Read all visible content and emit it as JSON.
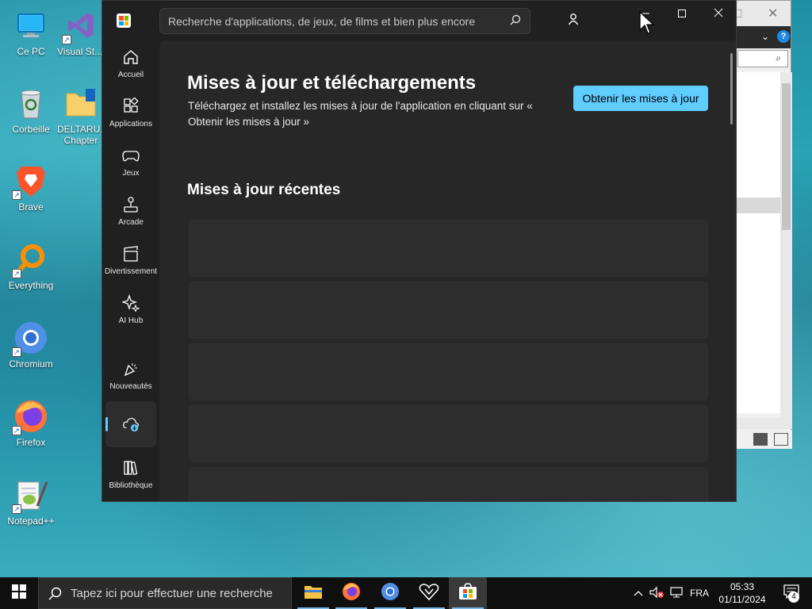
{
  "desktop": {
    "icons": [
      {
        "label": "Ce PC",
        "icon": "computer-icon"
      },
      {
        "label": "Visual St... 2017",
        "icon": "visual-studio-icon"
      },
      {
        "label": "Corbeille",
        "icon": "recycle-bin-icon"
      },
      {
        "label": "DELTARU... Chapter",
        "icon": "folder-icon"
      },
      {
        "label": "Brave",
        "icon": "brave-icon"
      },
      {
        "label": "Everything",
        "icon": "everything-icon"
      },
      {
        "label": "Chromium",
        "icon": "chromium-icon"
      },
      {
        "label": "Firefox",
        "icon": "firefox-icon"
      },
      {
        "label": "Notepad++",
        "icon": "notepadpp-icon"
      }
    ]
  },
  "store": {
    "search_placeholder": "Recherche d'applications, de jeux, de films et bien plus encore",
    "nav": [
      {
        "label": "Accueil",
        "icon": "home-icon"
      },
      {
        "label": "Applications",
        "icon": "apps-icon"
      },
      {
        "label": "Jeux",
        "icon": "gamepad-icon"
      },
      {
        "label": "Arcade",
        "icon": "joystick-icon"
      },
      {
        "label": "Divertissement",
        "icon": "clapperboard-icon"
      },
      {
        "label": "AI Hub",
        "icon": "sparkle-icon"
      },
      {
        "label": "Nouveautés",
        "icon": "party-icon"
      },
      {
        "label": "",
        "icon": "cloud-download-icon"
      },
      {
        "label": "Bibliothèque",
        "icon": "library-icon"
      }
    ],
    "main": {
      "title": "Mises à jour et téléchargements",
      "description": "Téléchargez et installez les mises à jour de l'application en cliquant sur « Obtenir les mises à jour »",
      "get_updates_button": "Obtenir les mises à jour",
      "recent_title": "Mises à jour récentes"
    }
  },
  "taskbar": {
    "search_placeholder": "Tapez ici pour effectuer une recherche",
    "language": "FRA",
    "time": "05:33",
    "date": "01/11/2024",
    "notification_count": "4"
  },
  "colors": {
    "accent": "#60cdff",
    "store_bg": "#202020",
    "main_bg": "#272727",
    "taskbar_bg": "#101010"
  }
}
